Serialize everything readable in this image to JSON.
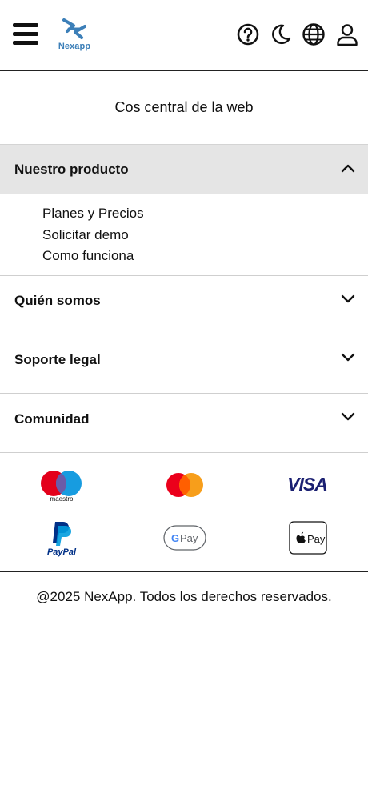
{
  "header": {
    "logo_text": "Nexapp",
    "icons": [
      "menu-icon",
      "help-icon",
      "dark-mode-icon",
      "language-icon",
      "user-icon"
    ]
  },
  "tagline": "Cos central de la web",
  "accordion": [
    {
      "title": "Nuestro producto",
      "expanded": true,
      "links": [
        "Planes y Precios",
        "Solicitar demo",
        "Como funciona"
      ]
    },
    {
      "title": "Quién somos",
      "expanded": false
    },
    {
      "title": "Soporte legal",
      "expanded": false
    },
    {
      "title": "Comunidad",
      "expanded": false
    }
  ],
  "payments": {
    "maestro_text": "maestro",
    "visa_text": "VISA",
    "paypal_text": "PayPal",
    "gpay_text": "Pay",
    "applepay_text": "Pay"
  },
  "footer": {
    "copyright": "@2025 NexApp. Todos los derechos reservados."
  },
  "colors": {
    "brand_blue": "#3c7fb8",
    "expanded_header_bg": "#e5e5e5"
  }
}
